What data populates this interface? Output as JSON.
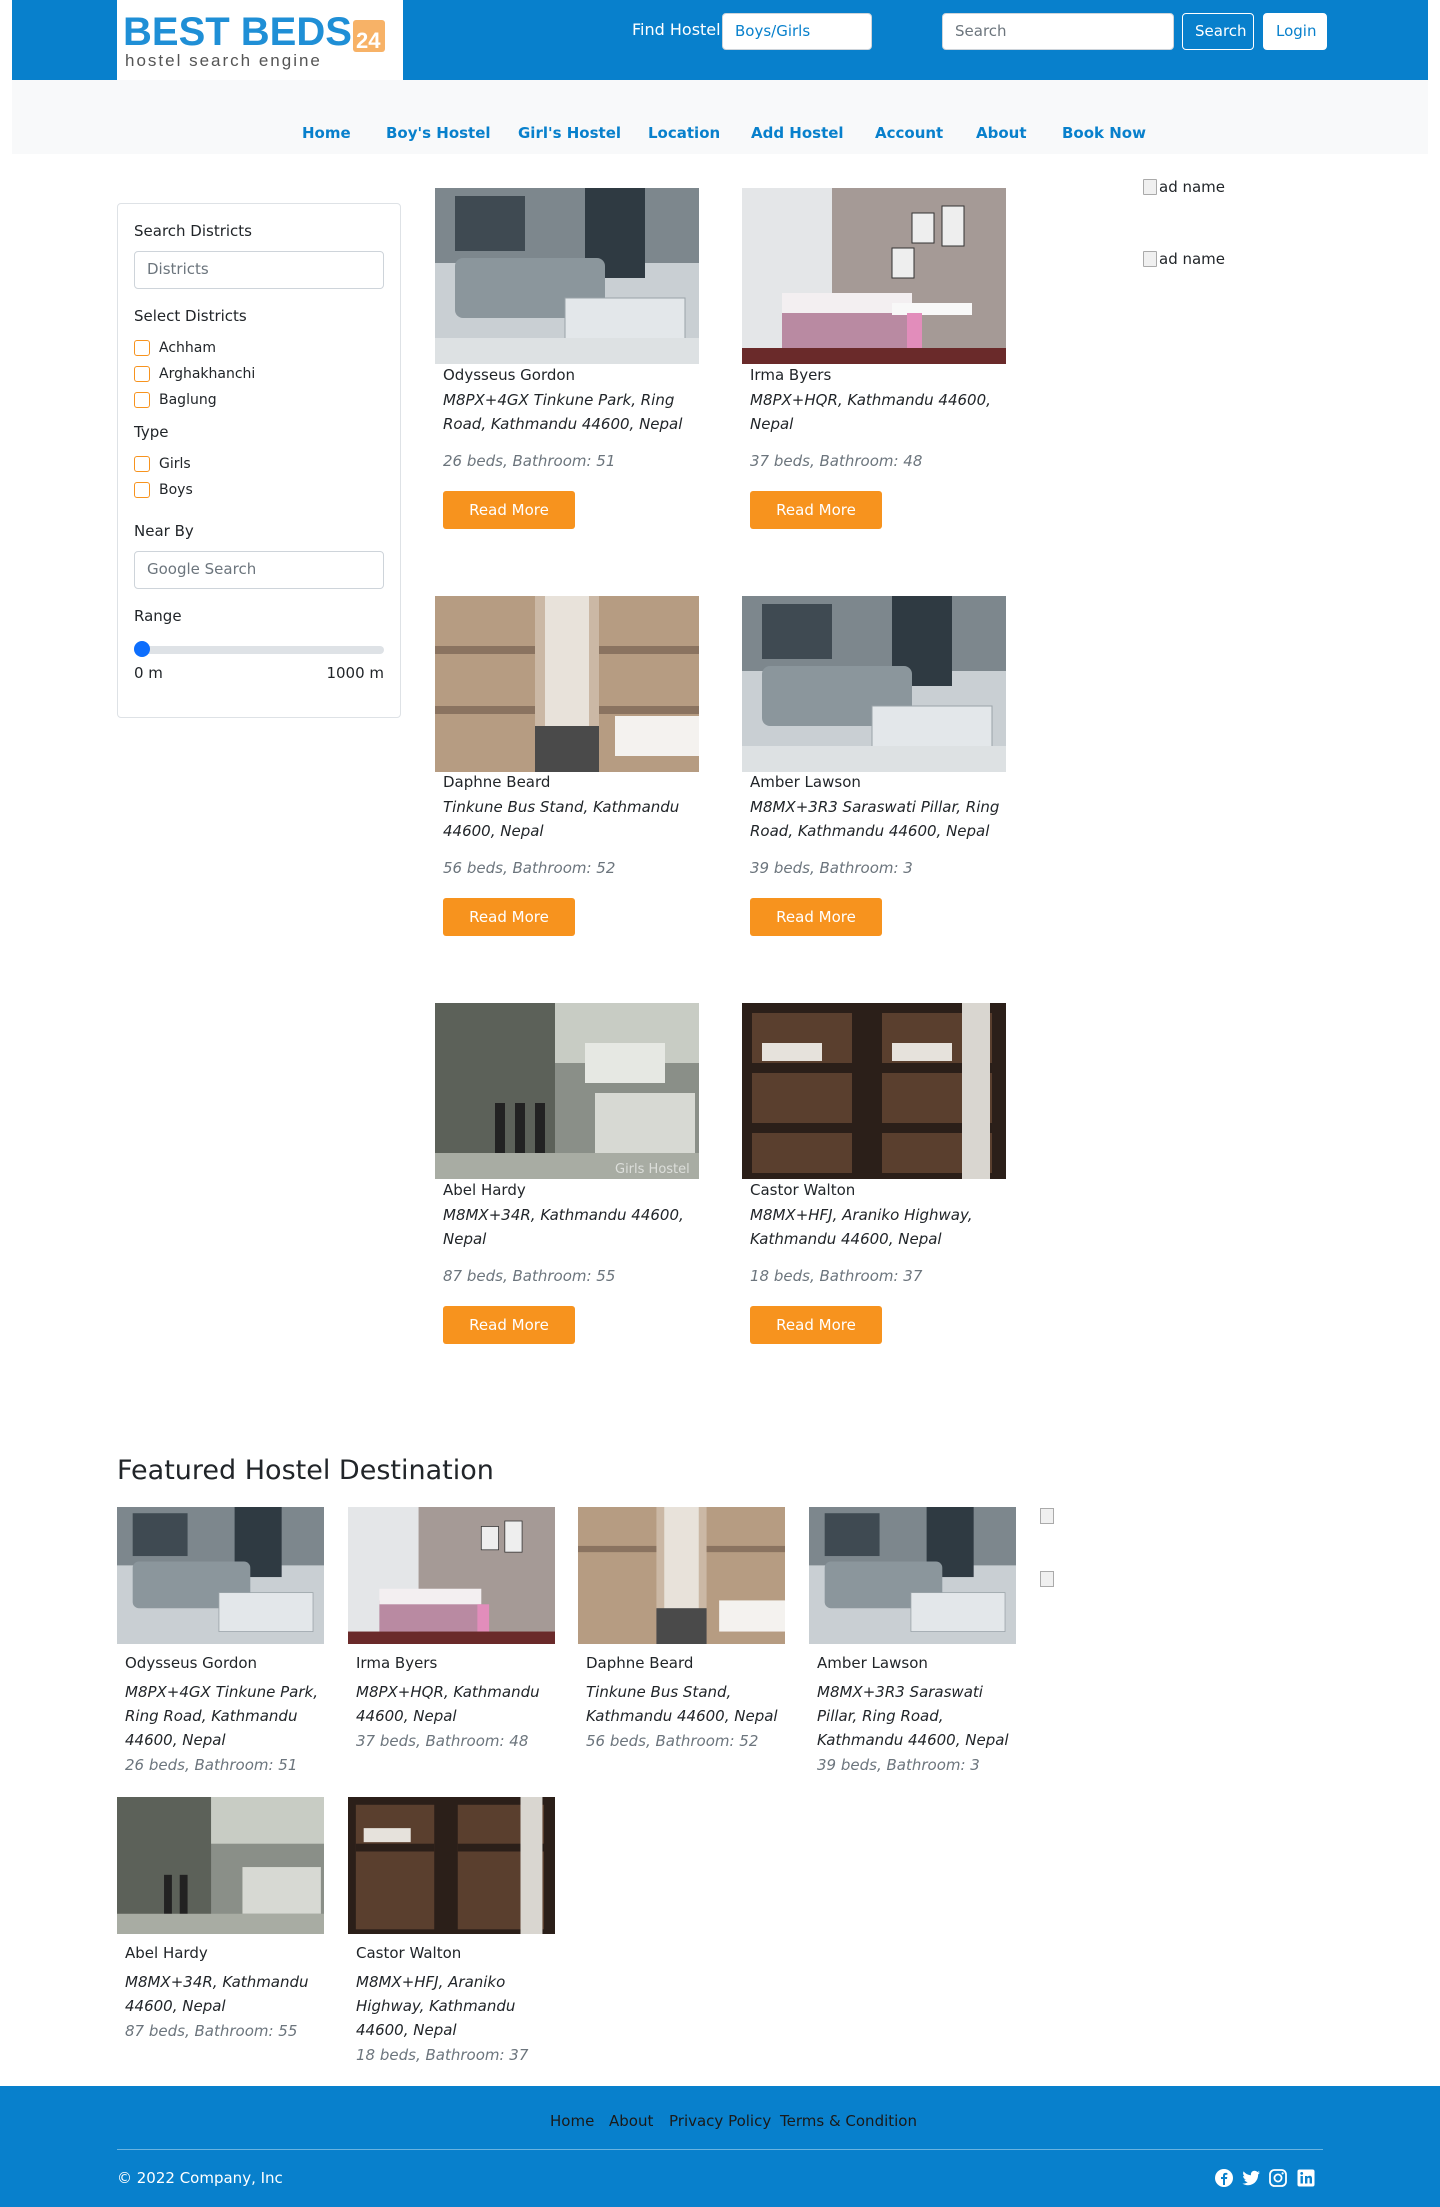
{
  "header": {
    "logo_text": "BEST BEDS",
    "logo_num": "24",
    "logo_tagline": "hostel search engine",
    "find_label": "Find Hostel",
    "type_select_value": "Boys/Girls",
    "search_placeholder": "Search",
    "search_button": "Search",
    "login_button": "Login"
  },
  "nav": {
    "items": [
      {
        "label": "Home"
      },
      {
        "label": "Boy's Hostel"
      },
      {
        "label": "Girl's Hostel"
      },
      {
        "label": "Location"
      },
      {
        "label": "Add Hostel"
      },
      {
        "label": "Account"
      },
      {
        "label": "About"
      },
      {
        "label": "Book Now"
      }
    ]
  },
  "filters": {
    "search_districts_label": "Search Districts",
    "districts_placeholder": "Districts",
    "select_districts_label": "Select Districts",
    "districts": [
      "Achham",
      "Arghakhanchi",
      "Baglung"
    ],
    "type_label": "Type",
    "types": [
      "Girls",
      "Boys"
    ],
    "near_by_label": "Near By",
    "near_by_placeholder": "Google Search",
    "range_label": "Range",
    "range_min": "0 m",
    "range_max": "1000 m",
    "range_value_fraction": 0
  },
  "hostels": [
    {
      "name": "Odysseus Gordon",
      "address": "M8PX+4GX Tinkune Park, Ring Road, Kathmandu 44600, Nepal",
      "meta": "26 beds, Bathroom: 51",
      "button": "Read More"
    },
    {
      "name": "Irma Byers",
      "address": "M8PX+HQR, Kathmandu 44600, Nepal",
      "meta": "37 beds, Bathroom: 48",
      "button": "Read More"
    },
    {
      "name": "Daphne Beard",
      "address": "Tinkune Bus Stand, Kathmandu 44600, Nepal",
      "meta": "56 beds, Bathroom: 52",
      "button": "Read More"
    },
    {
      "name": "Amber Lawson",
      "address": "M8MX+3R3 Saraswati Pillar, Ring Road, Kathmandu 44600, Nepal",
      "meta": "39 beds, Bathroom: 3",
      "button": "Read More"
    },
    {
      "name": "Abel Hardy",
      "address": "M8MX+34R, Kathmandu 44600, Nepal",
      "meta": "87 beds, Bathroom: 55",
      "button": "Read More"
    },
    {
      "name": "Castor Walton",
      "address": "M8MX+HFJ, Araniko Highway, Kathmandu 44600, Nepal",
      "meta": "18 beds, Bathroom: 37",
      "button": "Read More"
    }
  ],
  "image_watermark": "Girls Hostel",
  "ads": [
    {
      "alt": "ad name"
    },
    {
      "alt": "ad name"
    }
  ],
  "featured": {
    "title": "Featured Hostel Destination"
  },
  "footer": {
    "links": [
      "Home",
      "About",
      "Privacy Policy",
      "Terms & Condition"
    ],
    "copyright": "© 2022 Company, Inc",
    "social_icons": [
      "facebook-icon",
      "twitter-icon",
      "instagram-icon",
      "linkedin-icon"
    ]
  },
  "colors": {
    "brand_blue": "#0880cc",
    "accent_orange": "#f7931e",
    "muted_text": "#6c757d"
  }
}
